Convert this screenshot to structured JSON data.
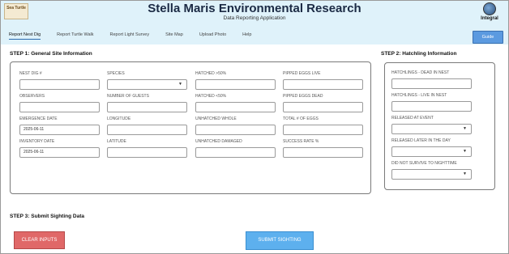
{
  "header": {
    "logo_left_text": "Sea Turtle",
    "title": "Stella Maris Environmental Research",
    "subtitle": "Data Reporting Application",
    "logo_right_text": "Integral",
    "bg_color": "#dff2fa"
  },
  "nav": {
    "items": [
      {
        "label": "Report Nest Dig",
        "active": true
      },
      {
        "label": "Report Turtle Walk",
        "active": false
      },
      {
        "label": "Report Light Survey",
        "active": false
      },
      {
        "label": "Site Map",
        "active": false
      },
      {
        "label": "Upload Photo",
        "active": false
      },
      {
        "label": "Help",
        "active": false
      }
    ],
    "guide_label": "Guide"
  },
  "step1": {
    "title": "STEP 1: General Site Information",
    "fields": [
      {
        "label": "NEST DIG #",
        "value": "",
        "type": "text"
      },
      {
        "label": "SPECIES",
        "value": "",
        "type": "select"
      },
      {
        "label": "HATCHED >50%",
        "value": "",
        "type": "text"
      },
      {
        "label": "PIPPED EGGS LIVE",
        "value": "",
        "type": "text"
      },
      {
        "label": "OBSERVERS",
        "value": "",
        "type": "text"
      },
      {
        "label": "NUMBER OF GUESTS",
        "value": "",
        "type": "text"
      },
      {
        "label": "HATCHED <50%",
        "value": "",
        "type": "text"
      },
      {
        "label": "PIPPED EGGS DEAD",
        "value": "",
        "type": "text"
      },
      {
        "label": "EMERGENCE DATE",
        "value": "2025-06-11",
        "type": "text"
      },
      {
        "label": "LONGITUDE",
        "value": "",
        "type": "text"
      },
      {
        "label": "UNHATCHED WHOLE",
        "value": "",
        "type": "text"
      },
      {
        "label": "TOTAL # OF EGGS",
        "value": "",
        "type": "text"
      },
      {
        "label": "INVENTORY DATE",
        "value": "2025-06-11",
        "type": "text"
      },
      {
        "label": "LATITUDE",
        "value": "",
        "type": "text"
      },
      {
        "label": "UNHATCHED DAMAGED",
        "value": "",
        "type": "text"
      },
      {
        "label": "SUCCESS RATE %",
        "value": "",
        "type": "text"
      }
    ]
  },
  "step2": {
    "title": "STEP 2: Hatchling Information",
    "fields": [
      {
        "label": "HATCHLINGS - DEAD IN NEST",
        "value": "",
        "type": "text"
      },
      {
        "label": "HATCHLINGS - LIVE IN NEST",
        "value": "",
        "type": "text"
      },
      {
        "label": "RELEASED AT EVENT",
        "value": "",
        "type": "select"
      },
      {
        "label": "RELEASED LATER IN THE DAY",
        "value": "",
        "type": "select"
      },
      {
        "label": "DID NOT SURVIVE TO NIGHTTIME",
        "value": "",
        "type": "select"
      }
    ]
  },
  "step3": {
    "title": "STEP 3: Submit Sighting Data",
    "clear_label": "CLEAR INPUTS",
    "submit_label": "SUBMIT SIGHTING",
    "clear_color": "#e06868",
    "submit_color": "#5db0ee"
  },
  "icons": {
    "dropdown": "chevron-down-icon",
    "caret_glyph": "▼"
  }
}
